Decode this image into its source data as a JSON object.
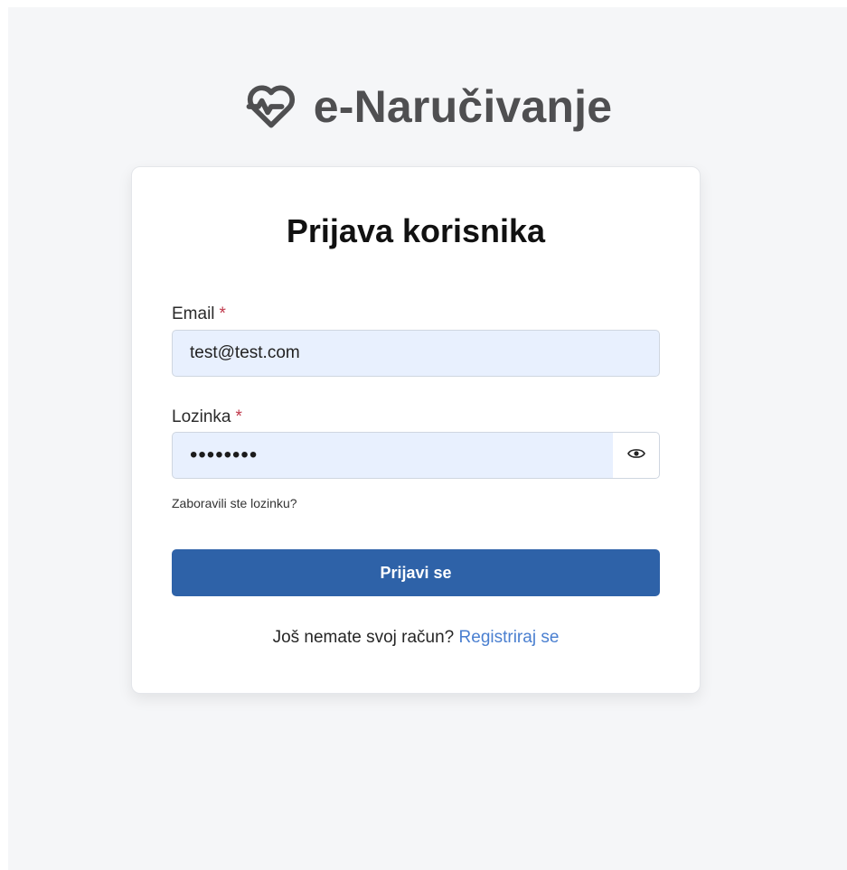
{
  "brand": {
    "icon": "heart-pulse-icon",
    "name": "e-Naručivanje"
  },
  "login": {
    "title": "Prijava korisnika",
    "email": {
      "label": "Email",
      "required_marker": "*",
      "value": "test@test.com"
    },
    "password": {
      "label": "Lozinka",
      "required_marker": "*",
      "masked_value": "••••••••",
      "toggle_icon": "eye-icon"
    },
    "forgot_password_link": "Zaboravili ste lozinku?",
    "submit_label": "Prijavi se",
    "register_prompt": "Još nemate svoj račun?",
    "register_link": "Registriraj se"
  },
  "colors": {
    "page_background": "#f5f6f8",
    "card_background": "#ffffff",
    "input_background": "#e8f0fe",
    "primary_button": "#2e62a8",
    "link": "#4a7fd0",
    "required": "#c0394b",
    "brand_text": "#4f4f51"
  }
}
